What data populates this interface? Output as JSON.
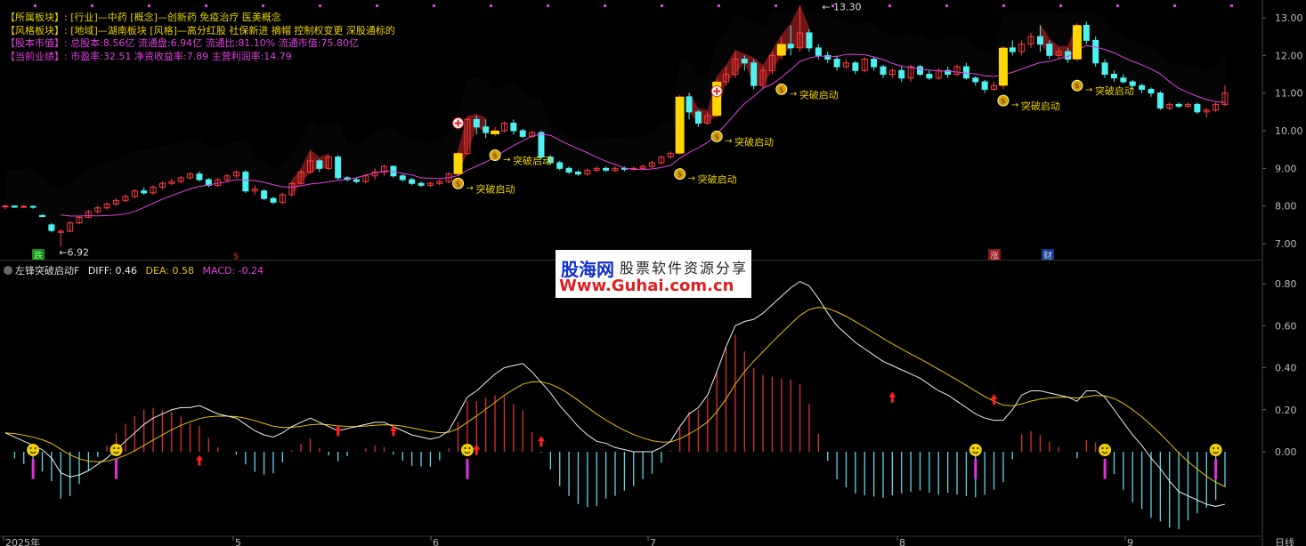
{
  "info_panel": [
    {
      "key": "【所属板块】:",
      "value": "[行业]—中药 [概念]—创新药 免疫治疗 医美概念",
      "style": "white"
    },
    {
      "key": "【风格板块】:",
      "value": "[地域]—湖南板块 [风格]—高分红股 社保新进 摘帽 控制权变更 深股通标的",
      "style": "gold"
    },
    {
      "key": "【股本市值】:",
      "value": "总股本:8.56亿 流通盘:6.94亿 流通比:81.10% 流通市值:75.80亿",
      "style": "pink"
    },
    {
      "key": "【当前业绩】:",
      "value": "市盈率:32.51 净资收益率:7.89 主营利润率:14.79",
      "style": "pink"
    }
  ],
  "indicator": {
    "name": "左锋突破启动F",
    "diff": "DIFF: 0.46",
    "dea": "DEA: 0.58",
    "macd": "MACD: -0.24"
  },
  "watermark": {
    "brand": "股海网",
    "slogan": "股票软件资源分享",
    "url": "Www.Guhai.com.cn"
  },
  "price_axis": [
    "13.00",
    "12.00",
    "11.00",
    "10.00",
    "9.00",
    "8.00",
    "7.00"
  ],
  "macd_axis": [
    "0.80",
    "0.60",
    "0.40",
    "0.20",
    "0.00"
  ],
  "time_axis": [
    "2025年",
    "5",
    "6",
    "7",
    "8",
    "9"
  ],
  "period_label": "日线",
  "annotations": {
    "high": "13.30",
    "low": "6.92",
    "breakout_label": "突破启动",
    "event_tags": [
      "跌",
      "涨",
      "财"
    ]
  },
  "colors": {
    "up": "#ff3d3d",
    "down": "#4ff0f0",
    "ma": "#e040e0",
    "diff": "#eeeeee",
    "dea": "#e8c000",
    "cloud": "#000000",
    "signal_bar": "#ffd700"
  },
  "chart_data": {
    "type": "candlestick",
    "ylim": [
      6.7,
      13.5
    ],
    "candles": [
      [
        7.98,
        8.0,
        7.92,
        8.04
      ],
      [
        8.0,
        7.97,
        7.95,
        8.02
      ],
      [
        7.97,
        7.99,
        7.94,
        8.03
      ],
      [
        7.99,
        7.97,
        7.93,
        8.02
      ],
      [
        7.75,
        7.72,
        7.7,
        7.78
      ],
      [
        7.5,
        7.35,
        7.3,
        7.55
      ],
      [
        7.3,
        7.33,
        6.92,
        7.38
      ],
      [
        7.33,
        7.55,
        7.3,
        7.6
      ],
      [
        7.55,
        7.7,
        7.52,
        7.75
      ],
      [
        7.7,
        7.85,
        7.68,
        7.9
      ],
      [
        7.85,
        7.95,
        7.8,
        8.0
      ],
      [
        7.95,
        8.05,
        7.9,
        8.1
      ],
      [
        8.05,
        8.15,
        8.0,
        8.2
      ],
      [
        8.15,
        8.25,
        8.1,
        8.3
      ],
      [
        8.25,
        8.4,
        8.2,
        8.45
      ],
      [
        8.4,
        8.35,
        8.3,
        8.5
      ],
      [
        8.35,
        8.5,
        8.3,
        8.55
      ],
      [
        8.5,
        8.6,
        8.45,
        8.65
      ],
      [
        8.6,
        8.65,
        8.55,
        8.72
      ],
      [
        8.65,
        8.75,
        8.6,
        8.8
      ],
      [
        8.75,
        8.85,
        8.7,
        8.9
      ],
      [
        8.85,
        8.7,
        8.65,
        8.92
      ],
      [
        8.7,
        8.55,
        8.5,
        8.75
      ],
      [
        8.55,
        8.7,
        8.5,
        8.75
      ],
      [
        8.7,
        8.8,
        8.65,
        8.85
      ],
      [
        8.8,
        8.9,
        8.75,
        8.95
      ],
      [
        8.9,
        8.4,
        8.35,
        8.95
      ],
      [
        8.4,
        8.45,
        8.3,
        8.55
      ],
      [
        8.4,
        8.2,
        8.15,
        8.45
      ],
      [
        8.2,
        8.1,
        8.05,
        8.25
      ],
      [
        8.1,
        8.3,
        8.05,
        8.35
      ],
      [
        8.3,
        8.6,
        8.25,
        8.65
      ],
      [
        8.6,
        8.9,
        8.55,
        8.95
      ],
      [
        8.9,
        9.2,
        8.85,
        9.45
      ],
      [
        9.2,
        9.0,
        8.9,
        9.25
      ],
      [
        9.0,
        9.3,
        8.95,
        9.35
      ],
      [
        9.3,
        8.75,
        8.7,
        9.35
      ],
      [
        8.75,
        8.7,
        8.65,
        8.8
      ],
      [
        8.7,
        8.65,
        8.6,
        8.75
      ],
      [
        8.65,
        8.8,
        8.6,
        8.85
      ],
      [
        8.8,
        8.9,
        8.7,
        9.0
      ],
      [
        8.9,
        9.05,
        8.8,
        9.1
      ],
      [
        9.05,
        8.8,
        8.75,
        9.08
      ],
      [
        8.8,
        8.7,
        8.65,
        8.85
      ],
      [
        8.7,
        8.6,
        8.55,
        8.75
      ],
      [
        8.6,
        8.55,
        8.5,
        8.65
      ],
      [
        8.55,
        8.6,
        8.5,
        8.65
      ],
      [
        8.6,
        8.65,
        8.55,
        8.7
      ],
      [
        8.65,
        8.85,
        8.6,
        8.9
      ],
      [
        8.85,
        9.4,
        8.8,
        9.45
      ],
      [
        9.4,
        10.3,
        9.35,
        10.35
      ],
      [
        10.3,
        10.1,
        9.9,
        10.4
      ],
      [
        10.1,
        9.95,
        9.8,
        10.3
      ],
      [
        9.95,
        10.0,
        9.85,
        10.1
      ],
      [
        10.0,
        10.2,
        9.95,
        10.25
      ],
      [
        10.2,
        10.0,
        9.9,
        10.3
      ],
      [
        10.0,
        9.85,
        9.8,
        10.05
      ],
      [
        9.85,
        9.95,
        9.8,
        10.0
      ],
      [
        9.95,
        9.3,
        9.25,
        10.0
      ],
      [
        9.3,
        9.15,
        9.1,
        9.35
      ],
      [
        9.15,
        9.0,
        8.95,
        9.2
      ],
      [
        9.0,
        8.9,
        8.85,
        9.05
      ],
      [
        8.9,
        8.85,
        8.8,
        8.95
      ],
      [
        8.85,
        8.95,
        8.8,
        9.0
      ],
      [
        8.95,
        9.0,
        8.9,
        9.05
      ],
      [
        9.0,
        8.95,
        8.9,
        9.05
      ],
      [
        8.95,
        9.0,
        8.9,
        9.05
      ],
      [
        9.0,
        8.98,
        8.92,
        9.05
      ],
      [
        8.98,
        9.0,
        8.95,
        9.05
      ],
      [
        9.0,
        9.05,
        8.95,
        9.1
      ],
      [
        9.05,
        9.15,
        9.0,
        9.2
      ],
      [
        9.15,
        9.3,
        9.1,
        9.35
      ],
      [
        9.3,
        9.4,
        9.25,
        9.45
      ],
      [
        9.4,
        10.9,
        9.35,
        10.95
      ],
      [
        10.9,
        10.5,
        10.3,
        11.0
      ],
      [
        10.5,
        10.2,
        10.1,
        10.55
      ],
      [
        10.2,
        10.4,
        10.15,
        10.5
      ],
      [
        10.4,
        11.3,
        10.35,
        11.4
      ],
      [
        11.3,
        11.5,
        11.2,
        11.7
      ],
      [
        11.5,
        11.9,
        11.4,
        12.1
      ],
      [
        11.9,
        11.8,
        11.6,
        12.0
      ],
      [
        11.8,
        11.2,
        11.1,
        11.9
      ],
      [
        11.2,
        11.6,
        11.1,
        11.7
      ],
      [
        11.6,
        12.0,
        11.5,
        12.1
      ],
      [
        12.0,
        12.3,
        11.9,
        12.5
      ],
      [
        12.3,
        12.2,
        12.0,
        12.8
      ],
      [
        12.2,
        12.6,
        12.1,
        13.3
      ],
      [
        12.6,
        12.2,
        12.1,
        12.7
      ],
      [
        12.2,
        12.0,
        11.9,
        12.3
      ],
      [
        12.0,
        11.9,
        11.8,
        12.1
      ],
      [
        11.9,
        11.7,
        11.6,
        12.0
      ],
      [
        11.7,
        11.8,
        11.65,
        11.9
      ],
      [
        11.8,
        11.6,
        11.5,
        11.85
      ],
      [
        11.6,
        11.9,
        11.55,
        11.95
      ],
      [
        11.9,
        11.7,
        11.6,
        11.95
      ],
      [
        11.7,
        11.5,
        11.4,
        11.75
      ],
      [
        11.5,
        11.6,
        11.4,
        11.65
      ],
      [
        11.6,
        11.4,
        11.3,
        11.7
      ],
      [
        11.4,
        11.7,
        11.3,
        11.75
      ],
      [
        11.7,
        11.5,
        11.45,
        11.75
      ],
      [
        11.5,
        11.4,
        11.35,
        11.6
      ],
      [
        11.4,
        11.6,
        11.35,
        11.65
      ],
      [
        11.6,
        11.5,
        11.4,
        11.7
      ],
      [
        11.5,
        11.7,
        11.45,
        11.75
      ],
      [
        11.7,
        11.4,
        11.35,
        11.8
      ],
      [
        11.4,
        11.3,
        11.2,
        11.45
      ],
      [
        11.3,
        11.1,
        11.0,
        11.35
      ],
      [
        11.1,
        11.2,
        11.05,
        11.3
      ],
      [
        11.2,
        12.2,
        11.1,
        12.25
      ],
      [
        12.2,
        12.1,
        12.0,
        12.4
      ],
      [
        12.1,
        12.3,
        12.0,
        12.4
      ],
      [
        12.3,
        12.5,
        12.2,
        12.6
      ],
      [
        12.5,
        12.3,
        12.1,
        12.8
      ],
      [
        12.3,
        12.0,
        11.9,
        12.4
      ],
      [
        12.0,
        12.1,
        11.9,
        12.2
      ],
      [
        12.1,
        11.9,
        11.8,
        12.2
      ],
      [
        11.9,
        12.8,
        11.85,
        12.85
      ],
      [
        12.8,
        12.4,
        12.3,
        12.9
      ],
      [
        12.4,
        11.8,
        11.7,
        12.5
      ],
      [
        11.8,
        11.5,
        11.4,
        11.9
      ],
      [
        11.5,
        11.4,
        11.3,
        11.6
      ],
      [
        11.4,
        11.3,
        11.25,
        11.5
      ],
      [
        11.3,
        11.2,
        11.1,
        11.35
      ],
      [
        11.2,
        11.1,
        11.0,
        11.25
      ],
      [
        11.1,
        11.0,
        10.9,
        11.15
      ],
      [
        11.0,
        10.6,
        10.55,
        11.05
      ],
      [
        10.6,
        10.7,
        10.55,
        10.75
      ],
      [
        10.7,
        10.65,
        10.6,
        10.75
      ],
      [
        10.65,
        10.7,
        10.6,
        10.75
      ],
      [
        10.7,
        10.5,
        10.45,
        10.75
      ],
      [
        10.5,
        10.55,
        10.35,
        10.6
      ],
      [
        10.55,
        10.7,
        10.5,
        10.75
      ],
      [
        10.7,
        11.0,
        10.65,
        11.2
      ]
    ],
    "breakout_signals": [
      {
        "index": 49,
        "y": 8.6
      },
      {
        "index": 53,
        "y": 9.35
      },
      {
        "index": 73,
        "y": 8.85
      },
      {
        "index": 77,
        "y": 9.85
      },
      {
        "index": 84,
        "y": 11.1
      },
      {
        "index": 108,
        "y": 10.8
      },
      {
        "index": 116,
        "y": 11.2
      }
    ],
    "macd": {
      "ylim": [
        -0.35,
        0.85
      ],
      "diff": [
        0.09,
        0.07,
        0.05,
        0.03,
        0.01,
        -0.03,
        -0.1,
        -0.12,
        -0.11,
        -0.09,
        -0.06,
        -0.03,
        0.01,
        0.05,
        0.09,
        0.13,
        0.16,
        0.18,
        0.2,
        0.21,
        0.21,
        0.22,
        0.2,
        0.18,
        0.17,
        0.16,
        0.13,
        0.1,
        0.08,
        0.07,
        0.09,
        0.12,
        0.14,
        0.16,
        0.14,
        0.12,
        0.1,
        0.11,
        0.12,
        0.13,
        0.14,
        0.14,
        0.12,
        0.1,
        0.08,
        0.07,
        0.06,
        0.07,
        0.1,
        0.18,
        0.26,
        0.29,
        0.33,
        0.37,
        0.4,
        0.41,
        0.42,
        0.38,
        0.33,
        0.28,
        0.22,
        0.17,
        0.12,
        0.08,
        0.05,
        0.04,
        0.02,
        0.01,
        0.0,
        0.0,
        0.0,
        0.02,
        0.05,
        0.12,
        0.18,
        0.21,
        0.27,
        0.38,
        0.5,
        0.6,
        0.62,
        0.63,
        0.66,
        0.7,
        0.74,
        0.78,
        0.81,
        0.79,
        0.73,
        0.66,
        0.6,
        0.56,
        0.52,
        0.49,
        0.46,
        0.43,
        0.41,
        0.39,
        0.37,
        0.35,
        0.32,
        0.29,
        0.27,
        0.24,
        0.21,
        0.18,
        0.16,
        0.15,
        0.15,
        0.2,
        0.27,
        0.29,
        0.29,
        0.28,
        0.27,
        0.26,
        0.24,
        0.29,
        0.29,
        0.26,
        0.2,
        0.14,
        0.08,
        0.03,
        -0.03,
        -0.08,
        -0.14,
        -0.19,
        -0.21,
        -0.23,
        -0.25,
        -0.26,
        -0.25
      ]
    }
  }
}
